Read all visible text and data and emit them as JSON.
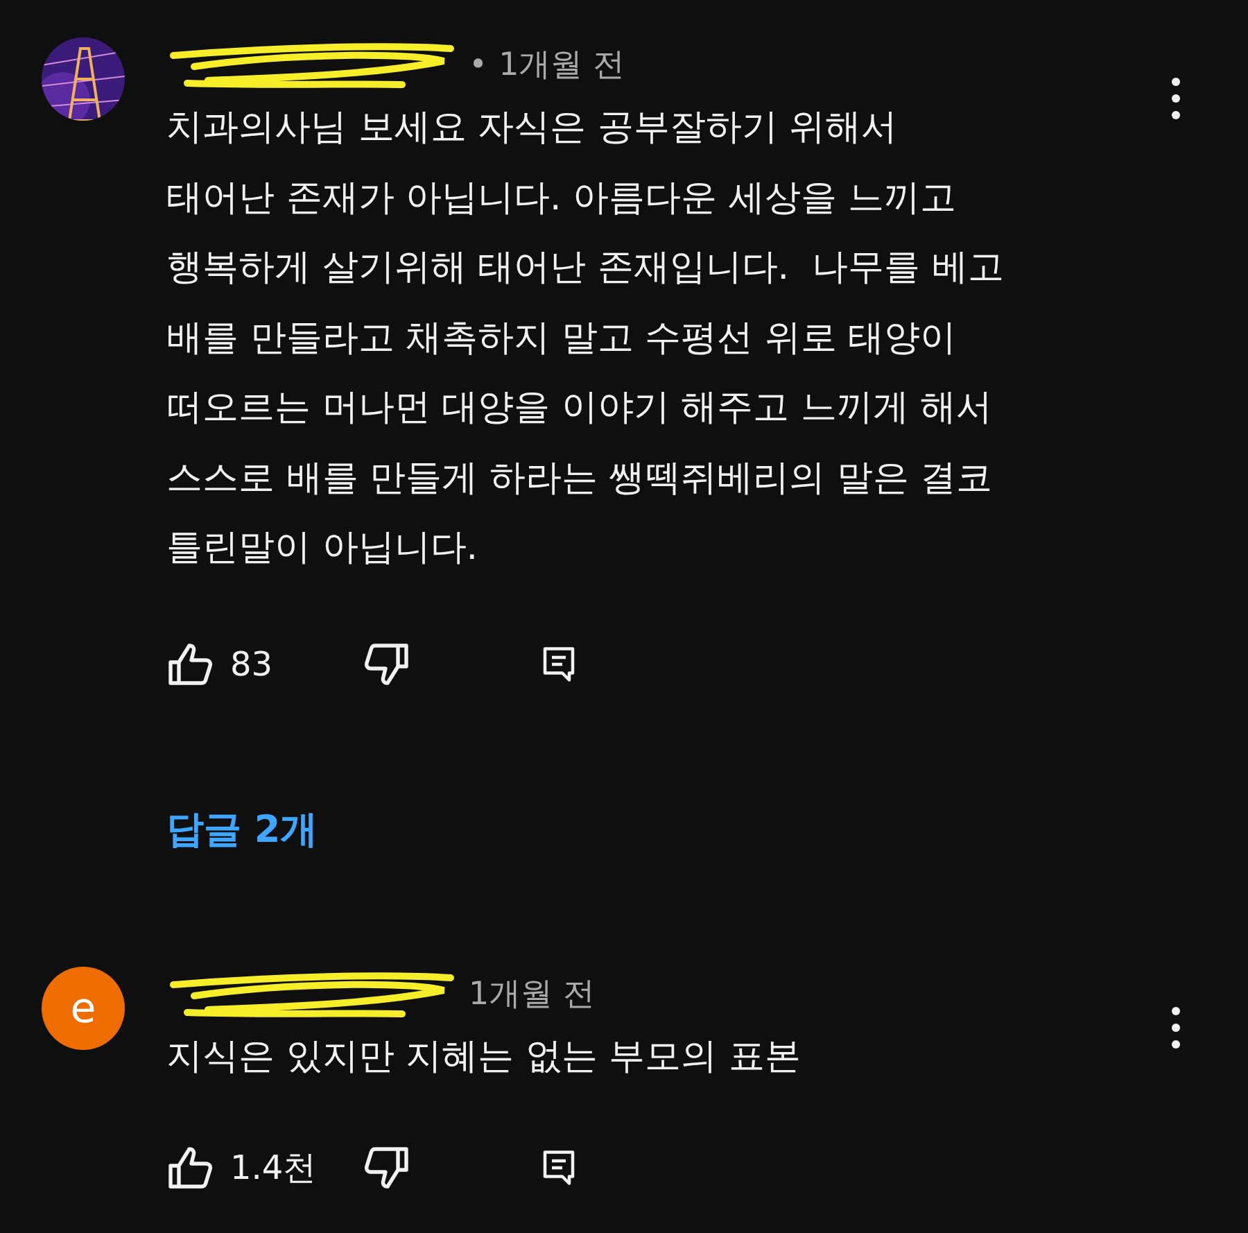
{
  "comments": [
    {
      "author_redacted": true,
      "separator": "•",
      "time": "1개월 전",
      "text": "치과의사님 보세요 자식은 공부잘하기 위해서\n태어난 존재가 아닙니다. 아름다운 세상을 느끼고\n행복하게 살기위해 태어난 존재입니다.  나무를 베고\n배를 만들라고 채촉하지 말고 수평선 위로 태양이\n떠오르는 머나먼 대양을 이야기 해주고 느끼게 해서\n스스로 배를 만들게 하라는 쌩떽쥐베리의 말은 결코\n틀린말이 아닙니다.",
      "likes": "83",
      "replies": "답글 2개"
    },
    {
      "avatar": {
        "kind": "letter",
        "letter": "e",
        "color": "#ef6c00"
      },
      "author_redacted": true,
      "time": "1개월 전",
      "text": "지식은 있지만 지혜는 없는 부모의 표본",
      "likes": "1.4천"
    }
  ]
}
